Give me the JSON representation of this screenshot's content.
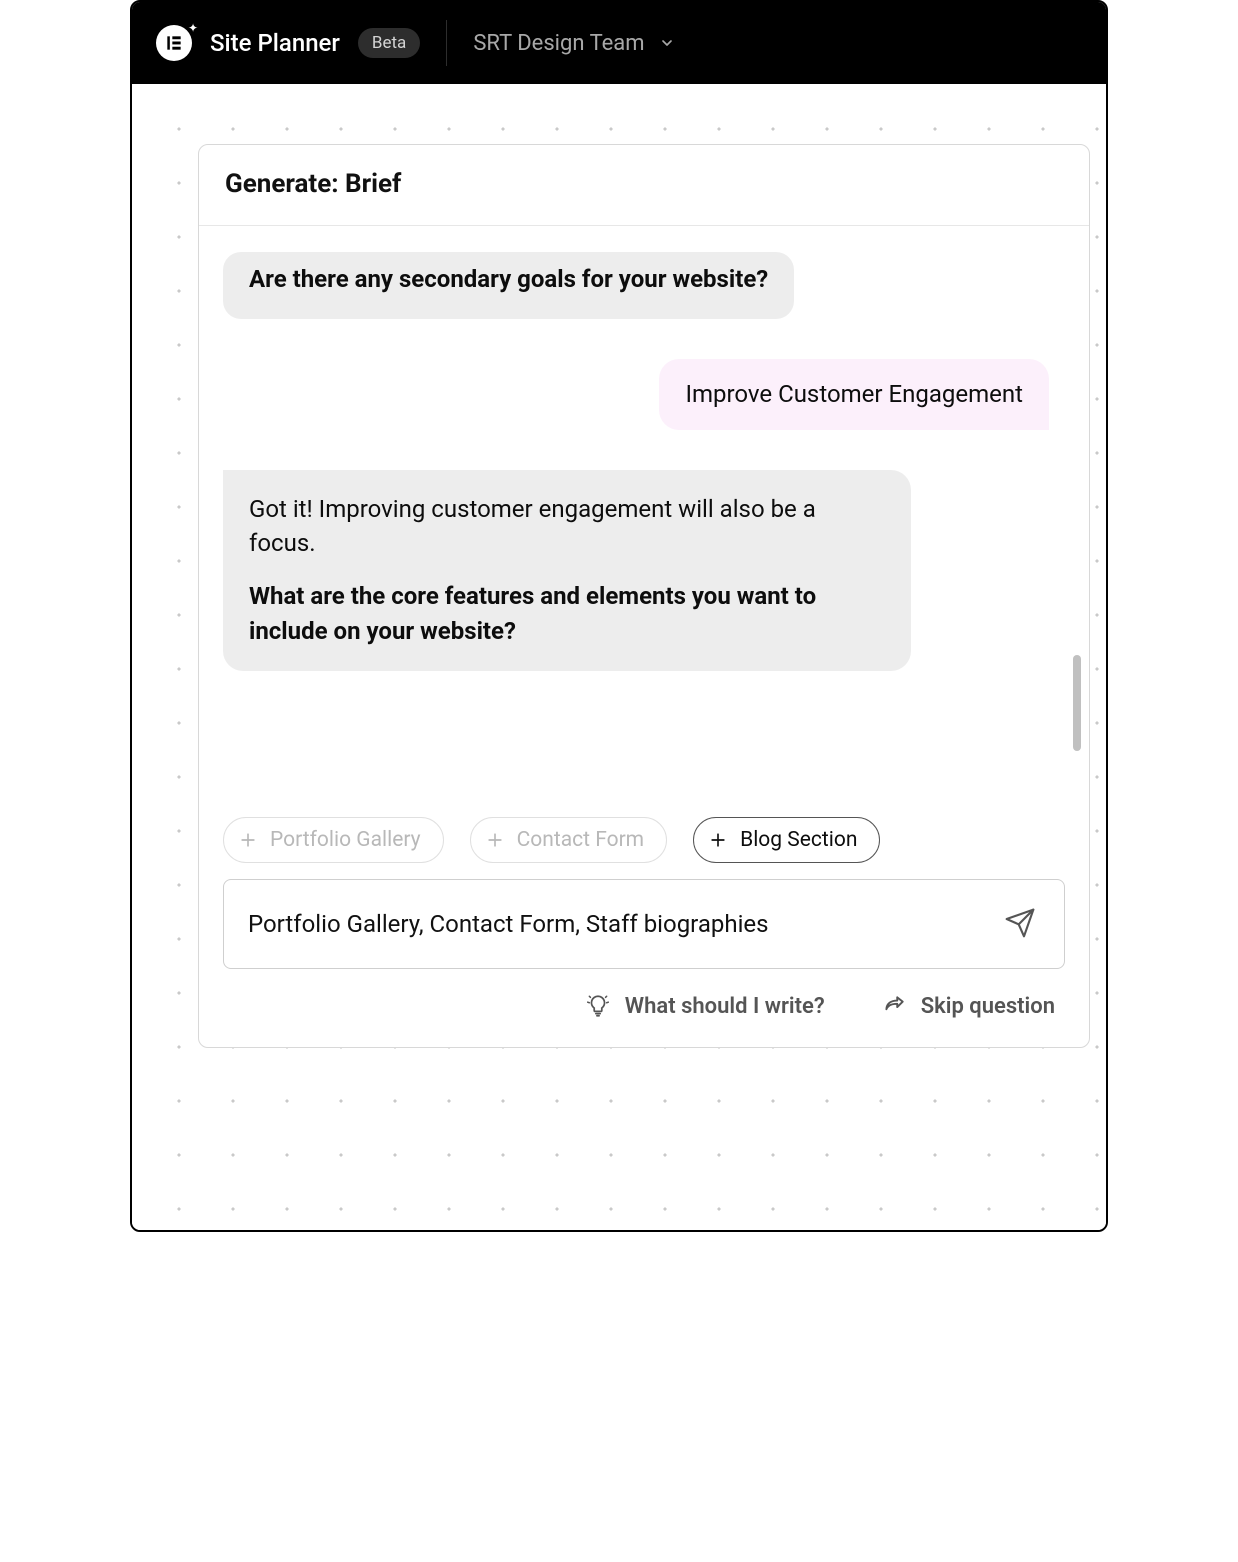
{
  "header": {
    "app_name": "Site Planner",
    "badge": "Beta",
    "team_name": "SRT Design Team"
  },
  "panel": {
    "title": "Generate: Brief"
  },
  "chat": {
    "m1_question": "Are there any secondary goals for your website?",
    "m2_user": "Improve Customer Engagement",
    "m3_text": "Got it! Improving customer engagement will also be a focus.",
    "m3_question": "What are the core features and elements you want to include on your website?"
  },
  "chips": {
    "c1": "Portfolio Gallery",
    "c2": "Contact Form",
    "c3": "Blog Section"
  },
  "input": {
    "value": "Portfolio Gallery, Contact Form, Staff biographies"
  },
  "actions": {
    "hint": "What should I write?",
    "skip": "Skip question"
  },
  "scroll": {
    "thumb_top_pct": 75,
    "thumb_height_pct": 18
  }
}
